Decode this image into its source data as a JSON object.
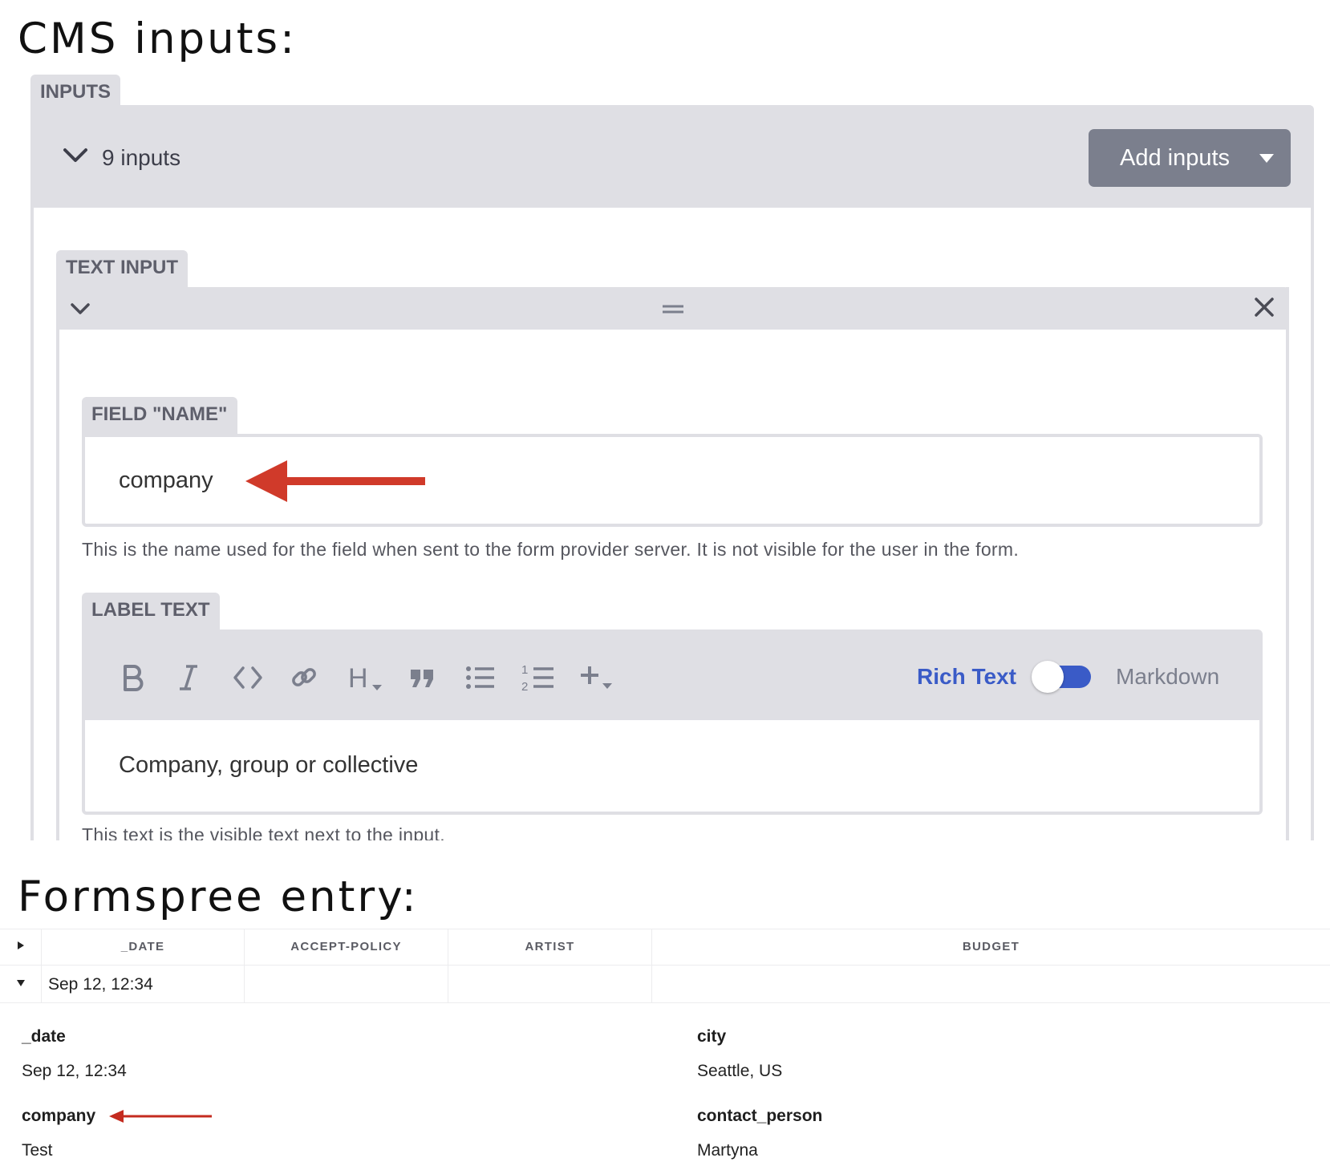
{
  "headings": {
    "cms": "CMS inputs:",
    "formspree": "Formspree entry:"
  },
  "cms": {
    "inputs_tab": "INPUTS",
    "inputs_count": "9 inputs",
    "add_inputs_label": "Add inputs",
    "text_input_tab": "TEXT INPUT",
    "field_name": {
      "tab": "FIELD \"NAME\"",
      "value": "company",
      "help": "This is the name used for the field when sent to the form provider server. It is not visible for the user in the form."
    },
    "label_text": {
      "tab": "LABEL TEXT",
      "toolbar_icons": [
        "bold-icon",
        "italic-icon",
        "code-icon",
        "link-icon",
        "heading-icon",
        "quote-icon",
        "bulleted-list-icon",
        "numbered-list-icon",
        "add-icon"
      ],
      "heading_glyph": "H",
      "numbers_glyph_1": "1",
      "numbers_glyph_2": "2",
      "rich_text_label": "Rich Text",
      "markdown_label": "Markdown",
      "mode_toggle_on": true,
      "value": "Company, group or collective",
      "help": "This text is the visible text next to the input."
    },
    "annotation_color": "#d03a2a"
  },
  "formspree": {
    "columns": [
      "_DATE",
      "ACCEPT-POLICY",
      "ARTIST",
      "BUDGET"
    ],
    "row": {
      "date": "Sep 12, 12:34"
    },
    "details": {
      "date_label": "_date",
      "date_value": "Sep 12, 12:34",
      "city_label": "city",
      "city_value": "Seattle, US",
      "company_label": "company",
      "company_value": "Test",
      "contact_label": "contact_person",
      "contact_value": "Martyna"
    }
  }
}
